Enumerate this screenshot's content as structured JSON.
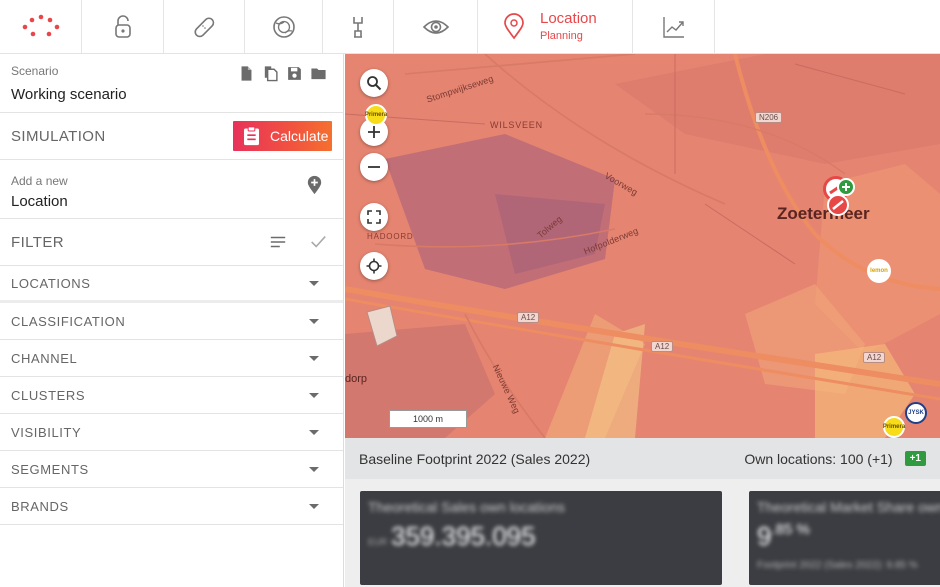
{
  "nav": {
    "items": [
      {
        "name": "nav-logo",
        "icon": "dots-logo"
      },
      {
        "name": "nav-lock",
        "icon": "lock-icon"
      },
      {
        "name": "nav-bandage",
        "icon": "bandage-icon"
      },
      {
        "name": "nav-globe",
        "icon": "globe-icon"
      },
      {
        "name": "nav-tools",
        "icon": "tools-icon"
      },
      {
        "name": "nav-eye",
        "icon": "eye-icon"
      },
      {
        "name": "nav-location",
        "icon": "map-pin-icon"
      },
      {
        "name": "nav-analytics",
        "icon": "chart-line-icon"
      }
    ],
    "active_title": "Location",
    "active_subtitle": "Planning",
    "accent": "#e8474a"
  },
  "sidebar": {
    "scenario_label": "Scenario",
    "scenario_value": "Working scenario",
    "simulation_title": "SIMULATION",
    "calculate_label": "Calculate",
    "add_label": "Add a new",
    "add_value": "Location",
    "filter_title": "FILTER",
    "sections": [
      "LOCATIONS",
      "CLASSIFICATION",
      "CHANNEL",
      "CLUSTERS",
      "VISIBILITY",
      "SEGMENTS",
      "BRANDS"
    ]
  },
  "map": {
    "labels": {
      "street_1": "Stompwijkseweg",
      "district_1": "WILSVEEN",
      "street_2": "Voorweg",
      "street_3": "Tolweg",
      "street_4": "Hofpolderweg",
      "district_2": "HADOORD",
      "street_5": "Nieuwe Weg",
      "city": "Zoetermeer",
      "city_partial": "dorp",
      "road_n206": "N206",
      "road_a12a": "A12",
      "road_a12b": "A12",
      "road_a12c": "A12",
      "scale": "1000 m"
    },
    "pins": {
      "yellow_top": "Primera",
      "yellow_bottom": "Primera",
      "yellow_right": "lemon",
      "jysk": "JYSK"
    }
  },
  "footprint": {
    "title": "Baseline Footprint 2022 (Sales 2022)",
    "own_locations": "Own locations: 100 (+1)",
    "badge": "+1",
    "card1": {
      "title": "Theoretical Sales own locations",
      "currency": "EUR",
      "value": "359.395.095"
    },
    "card2": {
      "title": "Theoretical Market Share own",
      "value_main": "9",
      "value_sup": ".85 %",
      "footer": "Footprint 2022 (Sales 2022): 9.85 %"
    }
  }
}
